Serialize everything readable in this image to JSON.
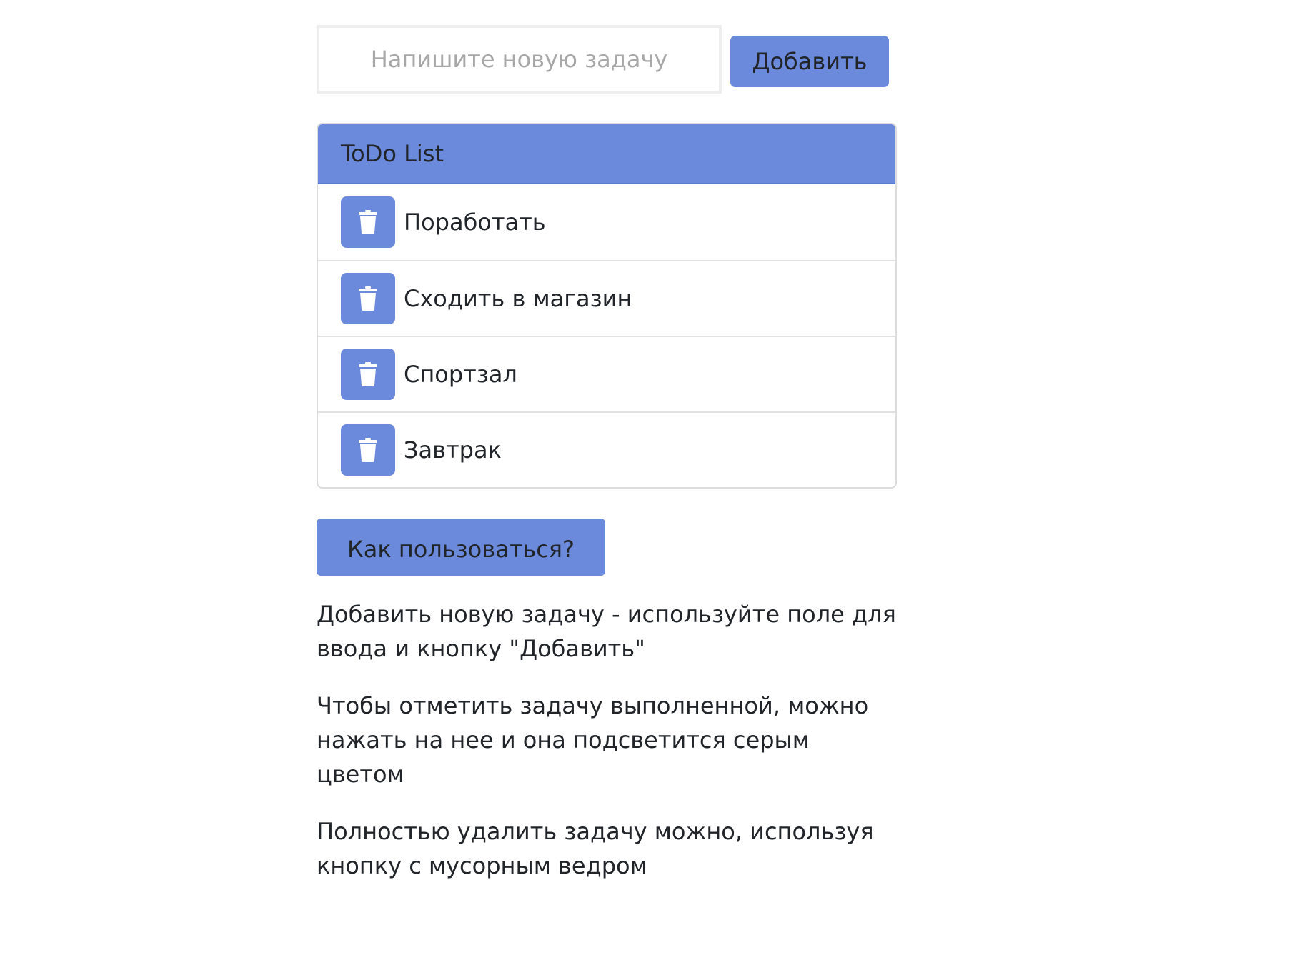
{
  "add_form": {
    "input_placeholder": "Напишите новую задачу",
    "input_value": "",
    "add_button_label": "Добавить"
  },
  "todo_card": {
    "title": "ToDo List",
    "items": [
      {
        "text": "Поработать"
      },
      {
        "text": "Сходить в магазин"
      },
      {
        "text": "Спортзал"
      },
      {
        "text": "Завтрак"
      }
    ]
  },
  "help": {
    "button_label": "Как пользоваться?",
    "paragraphs": [
      "Добавить новую задачу - используйте поле для ввода и кнопку \"Добавить\"",
      "Чтобы отметить задачу выполненной, можно нажать на нее и она подсветится серым цветом",
      "Полностью удалить задачу можно, используя кнопку с мусорным ведром"
    ]
  },
  "colors": {
    "accent": "#6c8adc",
    "text": "#212529",
    "placeholder": "#a7a7a7",
    "border": "#dcdcdc"
  },
  "icons": {
    "delete": "trash-icon"
  }
}
